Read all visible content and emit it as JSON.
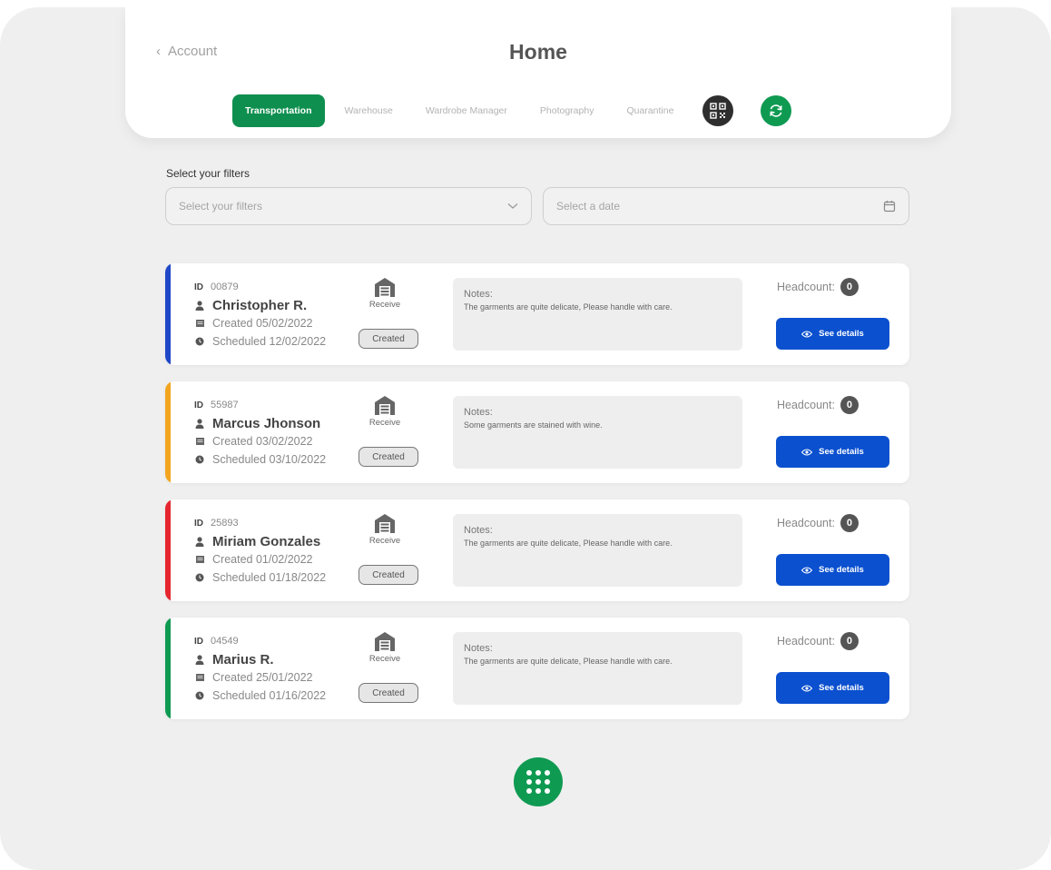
{
  "header": {
    "back_label": "Account",
    "title": "Home",
    "tabs": [
      {
        "label": "Transportation",
        "active": true
      },
      {
        "label": "Warehouse",
        "active": false
      },
      {
        "label": "Wardrobe Manager",
        "active": false
      },
      {
        "label": "Photography",
        "active": false
      },
      {
        "label": "Quarantine",
        "active": false
      }
    ],
    "actions": [
      {
        "icon": "qr-code-icon",
        "color": "#2e2e2e"
      },
      {
        "icon": "refresh-icon",
        "color": "#0f9a52"
      }
    ]
  },
  "filters": {
    "label": "Select your filters",
    "filter_placeholder": "Select your filters",
    "date_placeholder": "Select a date"
  },
  "labels": {
    "id": "ID",
    "notes_title": "Notes:",
    "headcount": "Headcount:",
    "see_details": "See details",
    "receive": "Receive"
  },
  "colors": {
    "primary_green": "#0f8f4f",
    "button_blue": "#0b50cf"
  },
  "orders": [
    {
      "id": "00879",
      "name": "Christopher R.",
      "created": "Created 05/02/2022",
      "scheduled": "Scheduled 12/02/2022",
      "status": "Created",
      "notes": "The garments are quite delicate, Please handle with care.",
      "headcount": "0",
      "accent": "#1f47c8"
    },
    {
      "id": "55987",
      "name": "Marcus Jhonson",
      "created": "Created 03/02/2022",
      "scheduled": "Scheduled 03/10/2022",
      "status": "Created",
      "notes": "Some garments are stained with wine.",
      "headcount": "0",
      "accent": "#f2a51f"
    },
    {
      "id": "25893",
      "name": "Miriam Gonzales",
      "created": "Created 01/02/2022",
      "scheduled": "Scheduled 01/18/2022",
      "status": "Created",
      "notes": "The garments are quite delicate, Please handle with care.",
      "headcount": "0",
      "accent": "#e5262f"
    },
    {
      "id": "04549",
      "name": "Marius R.",
      "created": "Created 25/01/2022",
      "scheduled": "Scheduled 01/16/2022",
      "status": "Created",
      "notes": "The garments are quite delicate, Please handle with care.",
      "headcount": "0",
      "accent": "#0f9a52"
    }
  ]
}
